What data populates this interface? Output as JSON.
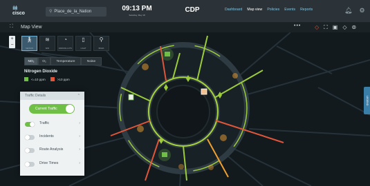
{
  "header": {
    "logo_bars": "ılıılı",
    "logo_text": "cisco",
    "location": "Place_de_la_Nation",
    "time": "09:13 PM",
    "date": "Saturday, May 18",
    "app_name": "CDP",
    "nav": [
      "Dashboard",
      "Map view",
      "Policies",
      "Events",
      "Reports"
    ],
    "nav_active": "Map view"
  },
  "subheader": {
    "title": "Map View"
  },
  "zoom": {
    "plus": "+",
    "minus": "−"
  },
  "modes": [
    {
      "label": "SENSOR",
      "icon": "pedestrian-icon"
    },
    {
      "label": "WIFI",
      "icon": "wifi-icon"
    },
    {
      "label": "PARKING LOTS",
      "icon": "timer-icon"
    },
    {
      "label": "LIGHT",
      "icon": "lamp-icon"
    },
    {
      "label": "BIKES",
      "icon": "bike-icon"
    }
  ],
  "layers": [
    "NO₂",
    "O₂",
    "Temperature",
    "Noise"
  ],
  "layer_active": "NO₂",
  "legend": {
    "title": "Nitrogen Dioxide",
    "low": "<=10 ppm",
    "high": ">10 ppm",
    "low_color": "#6fbf46",
    "high_color": "#e0563b"
  },
  "traffic_panel": {
    "title": "Traffic Details",
    "current_traffic": "Current Traffic",
    "rows": [
      {
        "label": "Traffic",
        "on": true
      },
      {
        "label": "Incidents",
        "on": false
      },
      {
        "label": "Route Analysis",
        "on": false
      },
      {
        "label": "Drive Times",
        "on": false
      }
    ]
  },
  "side_tab": "LEGEND",
  "colors": {
    "accent": "#3a7fa8",
    "green": "#6fbf46",
    "red": "#e0563b",
    "orange": "#f0a030"
  }
}
